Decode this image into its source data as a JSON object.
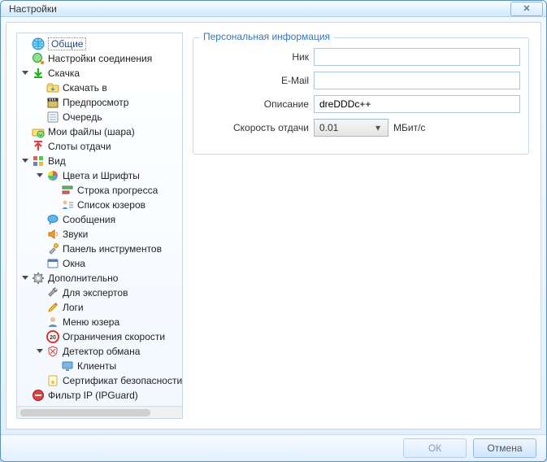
{
  "window": {
    "title": "Настройки"
  },
  "tree": {
    "general": "Общие",
    "connection": "Настройки соединения",
    "downloads": "Скачка",
    "downloads_to": "Скачать в",
    "preview": "Предпросмотр",
    "queue": "Очередь",
    "myfiles": "Мои файлы (шара)",
    "upload_slots": "Слоты отдачи",
    "appearance": "Вид",
    "colors_fonts": "Цвета и Шрифты",
    "progress_bar": "Строка прогресса",
    "user_list": "Список юзеров",
    "messages": "Сообщения",
    "sounds": "Звуки",
    "toolbar": "Панель инструментов",
    "windows": "Окна",
    "advanced": "Дополнительно",
    "experts": "Для экспертов",
    "logs": "Логи",
    "user_menu": "Меню юзера",
    "speed_limits": "Ограничения скорости",
    "cheat_detector": "Детектор обмана",
    "clients": "Клиенты",
    "cert": "Сертификат безопасности",
    "ipguard": "Фильтр IP (IPGuard)"
  },
  "group": {
    "title": "Персональная информация",
    "nick_label": "Ник",
    "nick_value": "",
    "email_label": "E-Mail",
    "email_value": "",
    "desc_label": "Описание",
    "desc_value": "dreDDDc++",
    "speed_label": "Скорость отдачи",
    "speed_value": "0.01",
    "speed_unit": "МБит/с"
  },
  "buttons": {
    "ok": "ОК",
    "cancel": "Отмена"
  }
}
